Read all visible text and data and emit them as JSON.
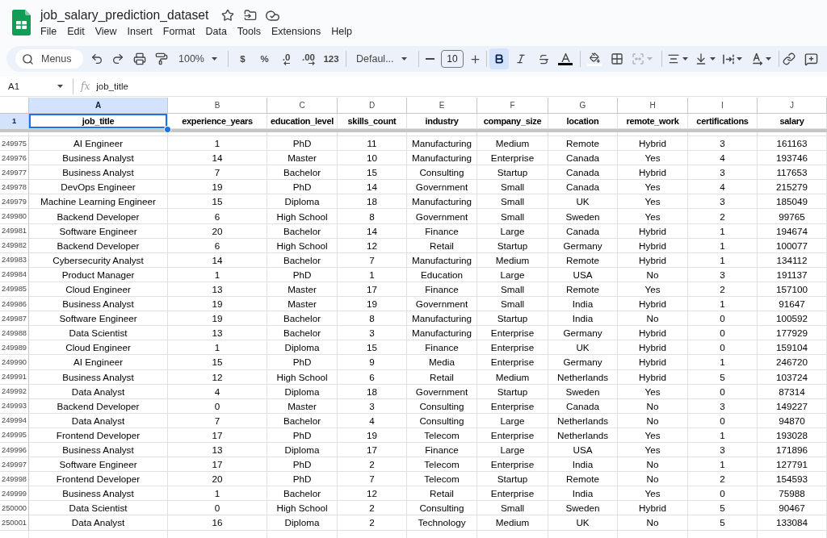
{
  "document": {
    "title": "job_salary_prediction_dataset",
    "menu": [
      "File",
      "Edit",
      "View",
      "Insert",
      "Format",
      "Data",
      "Tools",
      "Extensions",
      "Help"
    ]
  },
  "toolbar": {
    "search_label": "Menus",
    "zoom": "100%",
    "number_formats": [
      {
        "label": "$",
        "kind": "plain"
      },
      {
        "label": "%",
        "kind": "plain"
      },
      {
        "label": ".0",
        "kind": "decrease"
      },
      {
        "label": ".00",
        "kind": "increase"
      },
      {
        "label": "123",
        "kind": "plain"
      }
    ],
    "font": "Defaul...",
    "font_size": "10",
    "bold": true,
    "italic": false,
    "strikethrough": false,
    "color_buttons": [
      {
        "kind": "text",
        "color": "#000000"
      },
      {
        "kind": "fill",
        "color": "#ffffff"
      }
    ],
    "merge_disabled": true
  },
  "formula_bar": {
    "name_box": "A1",
    "fx": "fx",
    "formula": "job_title"
  },
  "columns": [
    {
      "letter": "A",
      "selected": true
    },
    {
      "letter": "B",
      "selected": false
    },
    {
      "letter": "C",
      "selected": false
    },
    {
      "letter": "D",
      "selected": false
    },
    {
      "letter": "E",
      "selected": false
    },
    {
      "letter": "F",
      "selected": false
    },
    {
      "letter": "G",
      "selected": false
    },
    {
      "letter": "H",
      "selected": false
    },
    {
      "letter": "I",
      "selected": false
    },
    {
      "letter": "J",
      "selected": false
    }
  ],
  "frozen_row": {
    "number": "1",
    "selected": true,
    "cells": [
      "job_title",
      "experience_years",
      "education_level",
      "skills_count",
      "industry",
      "company_size",
      "location",
      "remote_work",
      "certifications",
      "salary"
    ]
  },
  "rows": [
    {
      "number": "249975",
      "selected": false,
      "cells": [
        "AI Engineer",
        "1",
        "PhD",
        "11",
        "Manufacturing",
        "Medium",
        "Remote",
        "Hybrid",
        "3",
        "161163"
      ]
    },
    {
      "number": "249976",
      "selected": false,
      "cells": [
        "Business Analyst",
        "14",
        "Master",
        "10",
        "Manufacturing",
        "Enterprise",
        "Canada",
        "Yes",
        "4",
        "193746"
      ]
    },
    {
      "number": "249977",
      "selected": false,
      "cells": [
        "Business Analyst",
        "7",
        "Bachelor",
        "15",
        "Consulting",
        "Startup",
        "Canada",
        "Hybrid",
        "3",
        "117653"
      ]
    },
    {
      "number": "249978",
      "selected": false,
      "cells": [
        "DevOps Engineer",
        "19",
        "PhD",
        "14",
        "Government",
        "Small",
        "Canada",
        "Yes",
        "4",
        "215279"
      ]
    },
    {
      "number": "249979",
      "selected": false,
      "cells": [
        "Machine Learning Engineer",
        "15",
        "Diploma",
        "18",
        "Manufacturing",
        "Small",
        "UK",
        "Yes",
        "3",
        "185049"
      ]
    },
    {
      "number": "249980",
      "selected": false,
      "cells": [
        "Backend Developer",
        "6",
        "High School",
        "8",
        "Government",
        "Small",
        "Sweden",
        "Yes",
        "2",
        "99765"
      ]
    },
    {
      "number": "249981",
      "selected": false,
      "cells": [
        "Software Engineer",
        "20",
        "Bachelor",
        "14",
        "Finance",
        "Large",
        "Canada",
        "Hybrid",
        "1",
        "194674"
      ]
    },
    {
      "number": "249982",
      "selected": false,
      "cells": [
        "Backend Developer",
        "6",
        "High School",
        "12",
        "Retail",
        "Startup",
        "Germany",
        "Hybrid",
        "1",
        "100077"
      ]
    },
    {
      "number": "249983",
      "selected": false,
      "cells": [
        "Cybersecurity Analyst",
        "14",
        "Bachelor",
        "7",
        "Manufacturing",
        "Medium",
        "Remote",
        "Hybrid",
        "1",
        "134112"
      ]
    },
    {
      "number": "249984",
      "selected": false,
      "cells": [
        "Product Manager",
        "1",
        "PhD",
        "1",
        "Education",
        "Large",
        "USA",
        "No",
        "3",
        "191137"
      ]
    },
    {
      "number": "249985",
      "selected": false,
      "cells": [
        "Cloud Engineer",
        "13",
        "Master",
        "17",
        "Finance",
        "Small",
        "Remote",
        "Yes",
        "2",
        "157100"
      ]
    },
    {
      "number": "249986",
      "selected": false,
      "cells": [
        "Business Analyst",
        "19",
        "Master",
        "19",
        "Government",
        "Small",
        "India",
        "Hybrid",
        "1",
        "91647"
      ]
    },
    {
      "number": "249987",
      "selected": false,
      "cells": [
        "Software Engineer",
        "19",
        "Bachelor",
        "8",
        "Manufacturing",
        "Startup",
        "India",
        "No",
        "0",
        "100592"
      ]
    },
    {
      "number": "249988",
      "selected": false,
      "cells": [
        "Data Scientist",
        "13",
        "Bachelor",
        "3",
        "Manufacturing",
        "Enterprise",
        "Germany",
        "Hybrid",
        "0",
        "177929"
      ]
    },
    {
      "number": "249989",
      "selected": false,
      "cells": [
        "Cloud Engineer",
        "1",
        "Diploma",
        "15",
        "Finance",
        "Enterprise",
        "UK",
        "Hybrid",
        "0",
        "159104"
      ]
    },
    {
      "number": "249990",
      "selected": false,
      "cells": [
        "AI Engineer",
        "15",
        "PhD",
        "9",
        "Media",
        "Enterprise",
        "Germany",
        "Hybrid",
        "1",
        "246720"
      ]
    },
    {
      "number": "249991",
      "selected": false,
      "cells": [
        "Business Analyst",
        "12",
        "High School",
        "6",
        "Retail",
        "Medium",
        "Netherlands",
        "Hybrid",
        "5",
        "103724"
      ]
    },
    {
      "number": "249992",
      "selected": false,
      "cells": [
        "Data Analyst",
        "4",
        "Diploma",
        "18",
        "Government",
        "Startup",
        "Sweden",
        "Yes",
        "0",
        "87314"
      ]
    },
    {
      "number": "249993",
      "selected": false,
      "cells": [
        "Backend Developer",
        "0",
        "Master",
        "3",
        "Consulting",
        "Enterprise",
        "Canada",
        "No",
        "3",
        "149227"
      ]
    },
    {
      "number": "249994",
      "selected": false,
      "cells": [
        "Data Analyst",
        "7",
        "Bachelor",
        "4",
        "Consulting",
        "Large",
        "Netherlands",
        "No",
        "0",
        "94870"
      ]
    },
    {
      "number": "249995",
      "selected": false,
      "cells": [
        "Frontend Developer",
        "17",
        "PhD",
        "19",
        "Telecom",
        "Enterprise",
        "Netherlands",
        "Yes",
        "1",
        "193028"
      ]
    },
    {
      "number": "249996",
      "selected": false,
      "cells": [
        "Business Analyst",
        "13",
        "Diploma",
        "17",
        "Finance",
        "Large",
        "USA",
        "Yes",
        "3",
        "171896"
      ]
    },
    {
      "number": "249997",
      "selected": false,
      "cells": [
        "Software Engineer",
        "17",
        "PhD",
        "2",
        "Telecom",
        "Enterprise",
        "India",
        "No",
        "1",
        "127791"
      ]
    },
    {
      "number": "249998",
      "selected": false,
      "cells": [
        "Frontend Developer",
        "20",
        "PhD",
        "7",
        "Telecom",
        "Startup",
        "Remote",
        "No",
        "2",
        "154593"
      ]
    },
    {
      "number": "249999",
      "selected": false,
      "cells": [
        "Business Analyst",
        "1",
        "Bachelor",
        "12",
        "Retail",
        "Enterprise",
        "India",
        "Yes",
        "0",
        "75988"
      ]
    },
    {
      "number": "250000",
      "selected": false,
      "cells": [
        "Data Scientist",
        "0",
        "High School",
        "2",
        "Consulting",
        "Small",
        "Sweden",
        "Hybrid",
        "5",
        "90467"
      ]
    },
    {
      "number": "250001",
      "selected": false,
      "cells": [
        "Data Analyst",
        "16",
        "Diploma",
        "2",
        "Technology",
        "Medium",
        "UK",
        "No",
        "5",
        "133084"
      ]
    }
  ]
}
